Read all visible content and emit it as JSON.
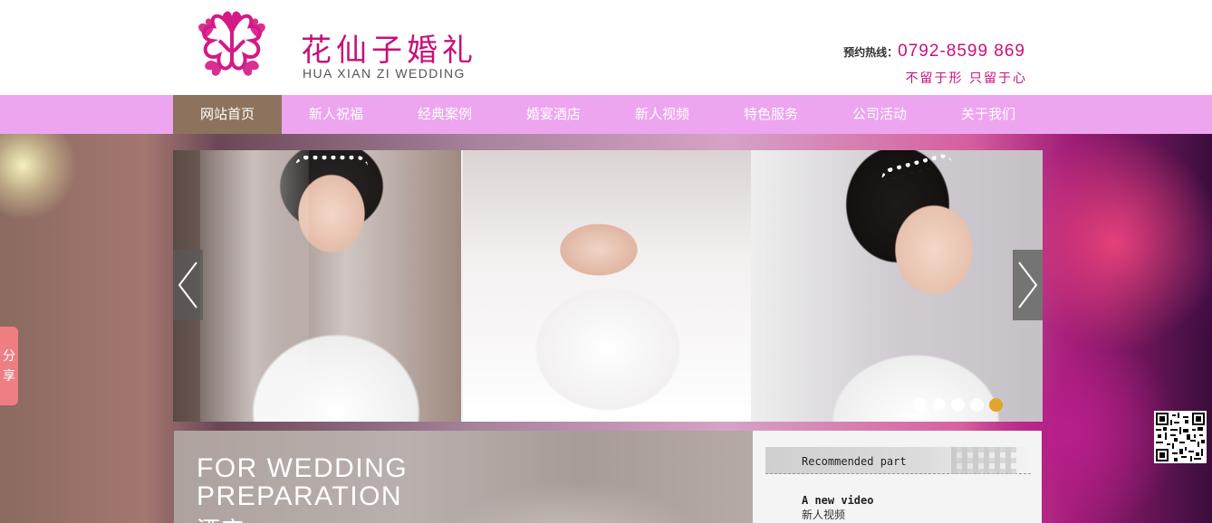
{
  "header": {
    "brand_cn": "花仙子婚礼",
    "brand_en": "HUA XIAN ZI WEDDING",
    "hotline_label": "预约热线：",
    "hotline_number": "0792-8599 869",
    "slogan": "不留于形 只留于心"
  },
  "nav": {
    "items": [
      {
        "label": "网站首页"
      },
      {
        "label": "新人祝福"
      },
      {
        "label": "经典案例"
      },
      {
        "label": "婚宴酒店"
      },
      {
        "label": "新人视频"
      },
      {
        "label": "特色服务"
      },
      {
        "label": "公司活动"
      },
      {
        "label": "关于我们"
      }
    ],
    "active_index": 0,
    "active_color": "#8d735e",
    "bar_color": "#eda5ef"
  },
  "slider": {
    "dot_count": 5,
    "active_dot": 5,
    "active_dot_color": "#e1a52a"
  },
  "share": {
    "label_1": "分",
    "label_2": "享"
  },
  "prep_panel": {
    "line1": "FOR WEDDING",
    "line2": "PREPARATION",
    "line3": "酒店"
  },
  "recommended": {
    "header_title": "Recommended part",
    "item_title": "A new video",
    "item_subtitle": "新人视频"
  },
  "colors": {
    "brand": "#c8107a",
    "share_tab": "#ef7e83"
  }
}
